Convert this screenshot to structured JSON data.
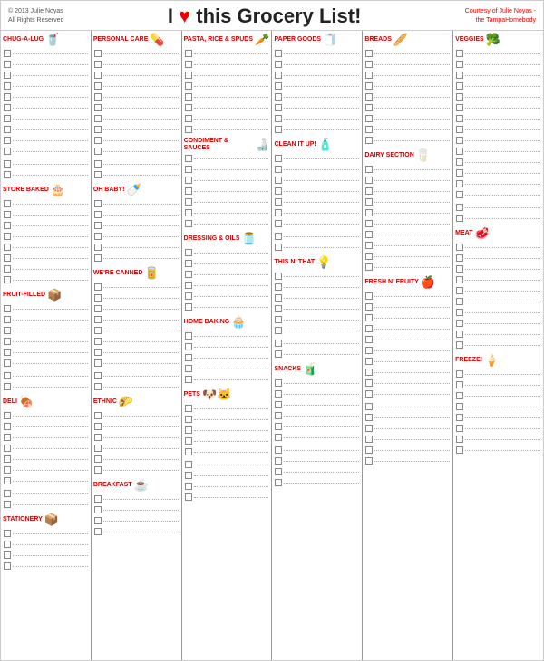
{
  "header": {
    "left_line1": "© 2013 Julie Noyas",
    "left_line2": "All Rights Reserved",
    "title_pre": "I",
    "title_heart": "♥",
    "title_post": " this Grocery List!",
    "right_line1": "Courtesy of Julie Noyas -",
    "right_line2": "the TampaHomebody"
  },
  "columns": [
    {
      "id": "col1",
      "sections": [
        {
          "title": "CHUG-A-LUG",
          "icon": "🥤",
          "rows": 10
        },
        {
          "title": "",
          "icon": "",
          "rows": 2
        },
        {
          "title": "STORE BAKED",
          "icon": "🎂",
          "rows": 8
        },
        {
          "title": "FRUIT-FILLED",
          "icon": "📦",
          "rows": 6
        },
        {
          "title": "",
          "icon": "",
          "rows": 2
        },
        {
          "title": "DELI",
          "icon": "🍖",
          "rows": 7
        },
        {
          "title": "",
          "icon": "",
          "rows": 2
        },
        {
          "title": "STATIONERY",
          "icon": "📦",
          "rows": 4
        }
      ]
    },
    {
      "id": "col2",
      "sections": [
        {
          "title": "PERSONAL CARE",
          "icon": "💊",
          "rows": 10
        },
        {
          "title": "",
          "icon": "",
          "rows": 2
        },
        {
          "title": "OH BABY!",
          "icon": "🍼",
          "rows": 6
        },
        {
          "title": "WE'RE CANNED",
          "icon": "🥫",
          "rows": 8
        },
        {
          "title": "",
          "icon": "",
          "rows": 2
        },
        {
          "title": "ETHNIC",
          "icon": "🌮",
          "rows": 6
        },
        {
          "title": "BREAKFAST",
          "icon": "☕",
          "rows": 4
        }
      ]
    },
    {
      "id": "col3",
      "sections": [
        {
          "title": "PASTA, RICE & SPUDS",
          "icon": "🥕",
          "rows": 8
        },
        {
          "title": "CONDIMENT & SAUCES",
          "icon": "🍶",
          "rows": 7
        },
        {
          "title": "DRESSING & OILS",
          "icon": "🫙",
          "rows": 6
        },
        {
          "title": "HOME BAKING",
          "icon": "🧁",
          "rows": 5
        },
        {
          "title": "PETS",
          "icon": "🐶🐱",
          "rows": 5
        },
        {
          "title": "",
          "icon": "",
          "rows": 4
        }
      ]
    },
    {
      "id": "col4",
      "sections": [
        {
          "title": "PAPER GOODS",
          "icon": "🧻",
          "rows": 8
        },
        {
          "title": "CLEAN IT UP!",
          "icon": "🧴",
          "rows": 7
        },
        {
          "title": "",
          "icon": "",
          "rows": 2
        },
        {
          "title": "THIS N' THAT",
          "icon": "💡",
          "rows": 6
        },
        {
          "title": "",
          "icon": "",
          "rows": 2
        },
        {
          "title": "SNACKS",
          "icon": "🧃",
          "rows": 6
        },
        {
          "title": "",
          "icon": "",
          "rows": 4
        }
      ]
    },
    {
      "id": "col5",
      "sections": [
        {
          "title": "BREADS",
          "icon": "🥖",
          "rows": 9
        },
        {
          "title": "DAIRY SECTION",
          "icon": "🥛",
          "rows": 10
        },
        {
          "title": "FRESH N' FRUITY",
          "icon": "🍎",
          "rows": 10
        },
        {
          "title": "",
          "icon": "",
          "rows": 6
        }
      ]
    },
    {
      "id": "col6",
      "sections": [
        {
          "title": "VEGGIES",
          "icon": "🥦",
          "rows": 14
        },
        {
          "title": "",
          "icon": "",
          "rows": 2
        },
        {
          "title": "MEAT",
          "icon": "🥩",
          "rows": 10
        },
        {
          "title": "FREEZE!",
          "icon": "🍦",
          "rows": 8
        }
      ]
    }
  ]
}
